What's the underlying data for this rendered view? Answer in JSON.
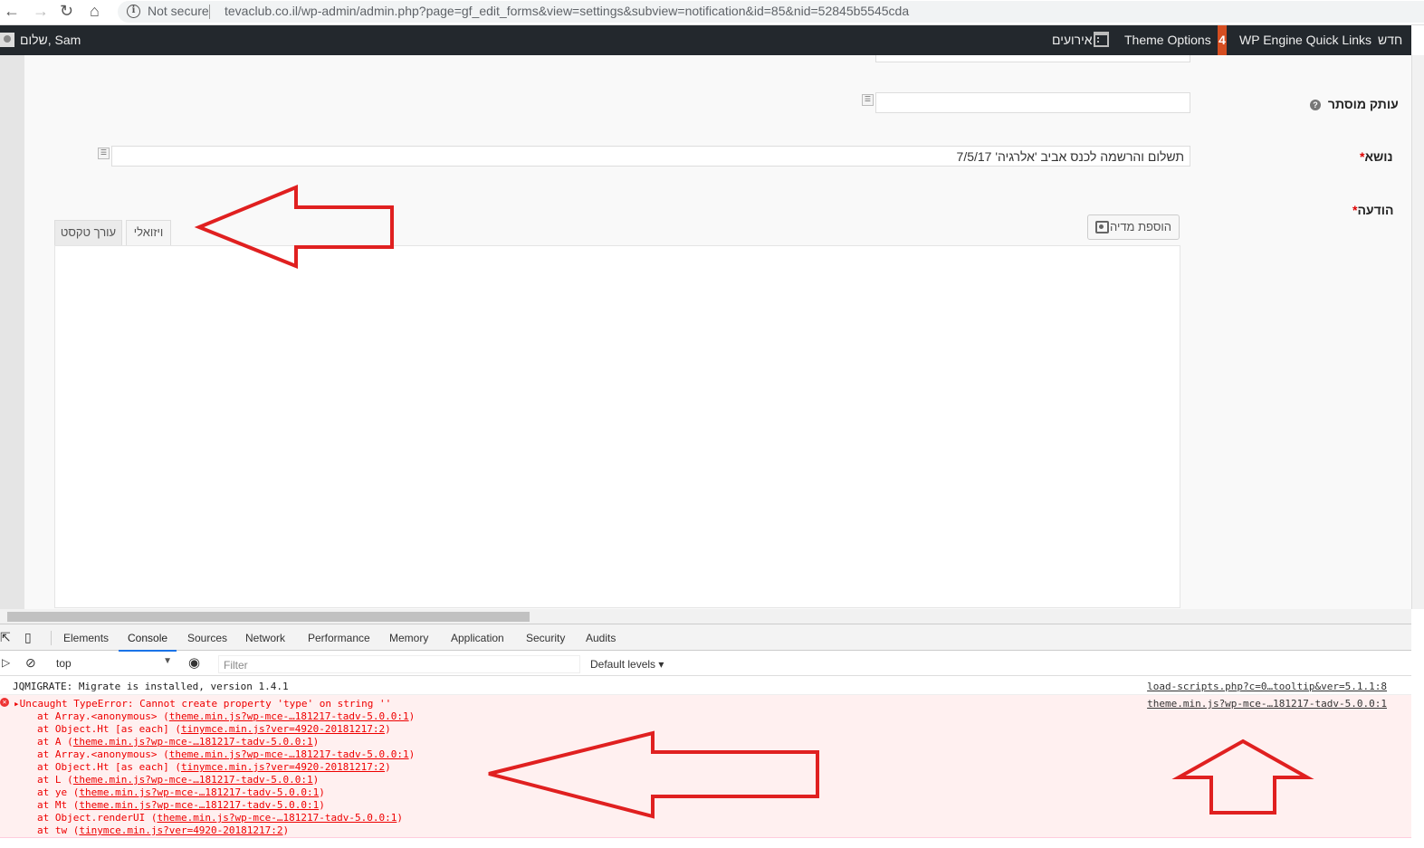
{
  "browser": {
    "security_label": "Not secure",
    "url": "tevaclub.co.il/wp-admin/admin.php?page=gf_edit_forms&view=settings&subview=notification&id=85&nid=52845b5545cda"
  },
  "admin_bar": {
    "greeting": "שלום, Sam",
    "events": "אירועים",
    "theme_options": "Theme Options",
    "notification_count": "4",
    "wp_engine": "WP Engine Quick Links",
    "new": "חדש"
  },
  "form": {
    "bcc_label": "עותק מוסתר",
    "subject_label": "נושא",
    "subject_value": "תשלום והרשמה לכנס אביב 'אלרגיה' 7/5/17",
    "message_label": "הודעה",
    "required_mark": "*",
    "add_media": "הוספת מדיה",
    "tab_visual": "ויזואלי",
    "tab_text": "עורך טקסט"
  },
  "devtools": {
    "tabs": [
      "Elements",
      "Console",
      "Sources",
      "Network",
      "Performance",
      "Memory",
      "Application",
      "Security",
      "Audits"
    ],
    "active_tab": "Console",
    "context": "top",
    "filter_placeholder": "Filter",
    "levels": "Default levels",
    "log": {
      "text": "JQMIGRATE: Migrate is installed, version 1.4.1",
      "source": "load-scripts.php?c=0…tooltip&ver=5.1.1:8"
    },
    "error": {
      "message": "Uncaught TypeError: Cannot create property 'type' on string ''",
      "source": "theme.min.js?wp-mce-…181217-tadv-5.0.0:1",
      "stack": [
        {
          "fn": "at Array.<anonymous>",
          "loc": "theme.min.js?wp-mce-…181217-tadv-5.0.0:1"
        },
        {
          "fn": "at Object.Ht [as each]",
          "loc": "tinymce.min.js?ver=4920-20181217:2"
        },
        {
          "fn": "at A",
          "loc": "theme.min.js?wp-mce-…181217-tadv-5.0.0:1"
        },
        {
          "fn": "at Array.<anonymous>",
          "loc": "theme.min.js?wp-mce-…181217-tadv-5.0.0:1"
        },
        {
          "fn": "at Object.Ht [as each]",
          "loc": "tinymce.min.js?ver=4920-20181217:2"
        },
        {
          "fn": "at L",
          "loc": "theme.min.js?wp-mce-…181217-tadv-5.0.0:1"
        },
        {
          "fn": "at ye",
          "loc": "theme.min.js?wp-mce-…181217-tadv-5.0.0:1"
        },
        {
          "fn": "at Mt",
          "loc": "theme.min.js?wp-mce-…181217-tadv-5.0.0:1"
        },
        {
          "fn": "at Object.renderUI",
          "loc": "theme.min.js?wp-mce-…181217-tadv-5.0.0:1"
        },
        {
          "fn": "at tw",
          "loc": "tinymce.min.js?ver=4920-20181217:2"
        }
      ]
    }
  },
  "colors": {
    "annotation_arrow": "#e02020",
    "admin_bar_bg": "#23282d",
    "error_text": "#e00000"
  }
}
